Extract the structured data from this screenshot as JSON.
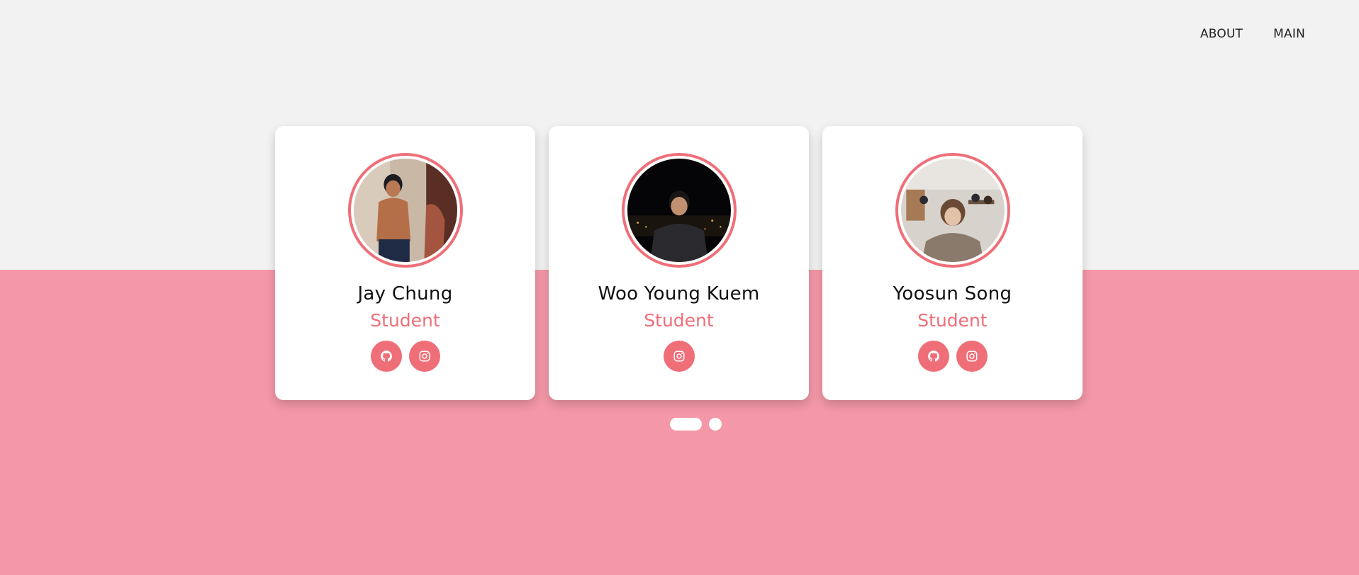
{
  "nav": {
    "about": "ABOUT",
    "main": "MAIN"
  },
  "cards": [
    {
      "name": "Jay Chung",
      "role": "Student",
      "socials": [
        "github-icon",
        "instagram-icon"
      ]
    },
    {
      "name": "Woo Young Kuem",
      "role": "Student",
      "socials": [
        "instagram-icon"
      ]
    },
    {
      "name": "Yoosun Song",
      "role": "Student",
      "socials": [
        "github-icon",
        "instagram-icon"
      ]
    }
  ],
  "carousel": {
    "pages": 2,
    "active_page": 1
  },
  "colors": {
    "background_top": "#f2f2f2",
    "background_bottom": "#f497a8",
    "accent": "#ef6f79",
    "card": "#ffffff"
  }
}
